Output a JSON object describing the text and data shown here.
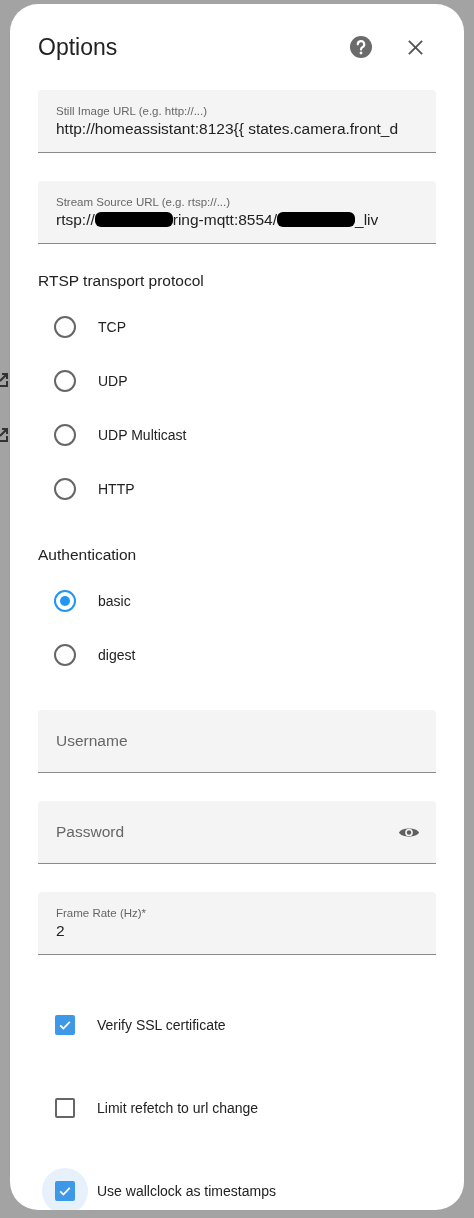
{
  "dialog": {
    "title": "Options"
  },
  "url_fields": [
    {
      "label": "Still Image URL (e.g. http://...)",
      "value": [
        {
          "kind": "text",
          "text": "http://homeassistant:8123{{ states.camera.front_d"
        }
      ]
    },
    {
      "label": "Stream Source URL (e.g. rtsp://...)",
      "value": [
        {
          "kind": "text",
          "text": "rtsp://"
        },
        {
          "kind": "redacted"
        },
        {
          "kind": "text",
          "text": "ring-mqtt:8554/"
        },
        {
          "kind": "redacted"
        },
        {
          "kind": "text",
          "text": "_liv"
        }
      ]
    }
  ],
  "rtsp_transport": {
    "heading": "RTSP transport protocol",
    "options": [
      {
        "label": "TCP",
        "selected": false
      },
      {
        "label": "UDP",
        "selected": false
      },
      {
        "label": "UDP Multicast",
        "selected": false
      },
      {
        "label": "HTTP",
        "selected": false
      }
    ]
  },
  "authentication": {
    "heading": "Authentication",
    "options": [
      {
        "label": "basic",
        "selected": true
      },
      {
        "label": "digest",
        "selected": false
      }
    ]
  },
  "credentials": [
    {
      "placeholder": "Username",
      "kind": "text"
    },
    {
      "placeholder": "Password",
      "kind": "password"
    }
  ],
  "frame_rate": {
    "label": "Frame Rate (Hz)*",
    "value": "2"
  },
  "checkboxes": [
    {
      "label": "Verify SSL certificate",
      "checked": true,
      "focused": false
    },
    {
      "label": "Limit refetch to url change",
      "checked": false,
      "focused": false
    },
    {
      "label": "Use wallclock as timestamps",
      "checked": true,
      "focused": true
    }
  ]
}
